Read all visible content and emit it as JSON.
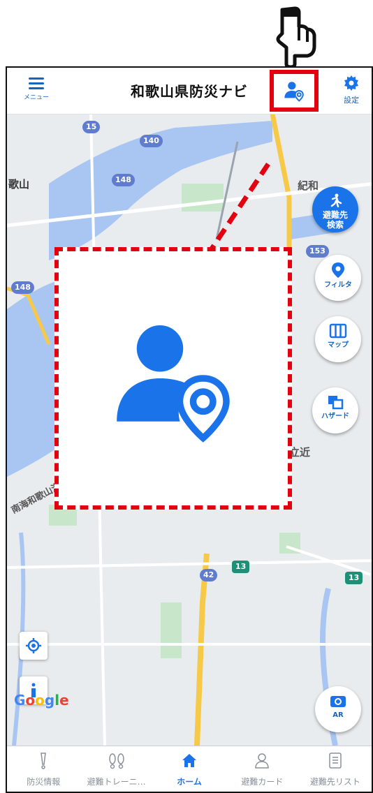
{
  "header": {
    "menu_label": "メニュー",
    "title": "和歌山県防災ナビ",
    "settings_label": "設定"
  },
  "map": {
    "labels": {
      "wakayama": "歌山",
      "kiwa": "紀和",
      "tachigasaki": "立近",
      "nankai": "南海和歌山港"
    },
    "route_numbers": [
      "15",
      "140",
      "148",
      "148",
      "153",
      "13",
      "42",
      "13"
    ],
    "attribution": [
      "G",
      "o",
      "o",
      "g",
      "l",
      "e"
    ]
  },
  "fabs": {
    "evac_search_label": "避難先検索",
    "filter_label": "フィルタ",
    "map_label": "マップ",
    "hazard_label": "ハザード",
    "ar_label": "AR"
  },
  "tabs": [
    {
      "label": "防災情報",
      "icon": "alert-icon",
      "active": false
    },
    {
      "label": "避難トレーニ…",
      "icon": "footprints-icon",
      "active": false
    },
    {
      "label": "ホーム",
      "icon": "home-icon",
      "active": true
    },
    {
      "label": "避難カード",
      "icon": "person-icon",
      "active": false
    },
    {
      "label": "避難先リスト",
      "icon": "list-icon",
      "active": false
    }
  ],
  "colors": {
    "accent": "#1a73e8",
    "highlight": "#e3000f",
    "water": "#a9c6f2"
  }
}
